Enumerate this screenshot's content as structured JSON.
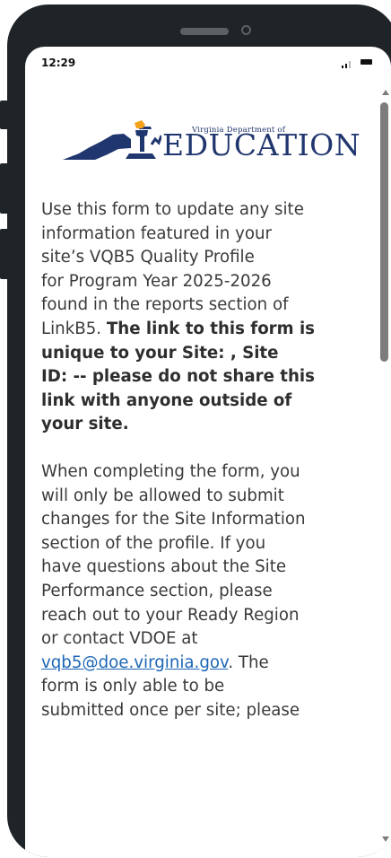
{
  "status_bar": {
    "time": "12:29"
  },
  "logo": {
    "small_text": "Virginia Department of",
    "big_text": "EDUCATION",
    "alt_colors": {
      "navy": "#20366e",
      "flame": "#f3a21b"
    }
  },
  "content": {
    "p1_regular": "Use this form to update any site\ninformation featured in your\nsite’s VQB5 Quality Profile\nfor Program Year 2025-2026\nfound in the reports section of\nLinkB5. ",
    "p1_bold": "The link to this form is\nunique to your Site: , Site\nID:  -- please do not share this\nlink with anyone outside of\nyour site.",
    "p2_regular": "When completing the form, you\nwill only be allowed to submit\nchanges for the Site Information\nsection of the profile. If you\nhave questions about the Site\nPerformance section, please\nreach out to your Ready Region\nor contact VDOE at\n",
    "email_link": "vqb5@doe.virginia.gov",
    "p2_after_link": ". The\nform is only able to be\nsubmitted once per site; please"
  },
  "icons": {
    "signal": "signal-icon",
    "battery": "battery-icon",
    "scroll_up": "arrow-up-icon",
    "scroll_down": "arrow-down-icon"
  }
}
